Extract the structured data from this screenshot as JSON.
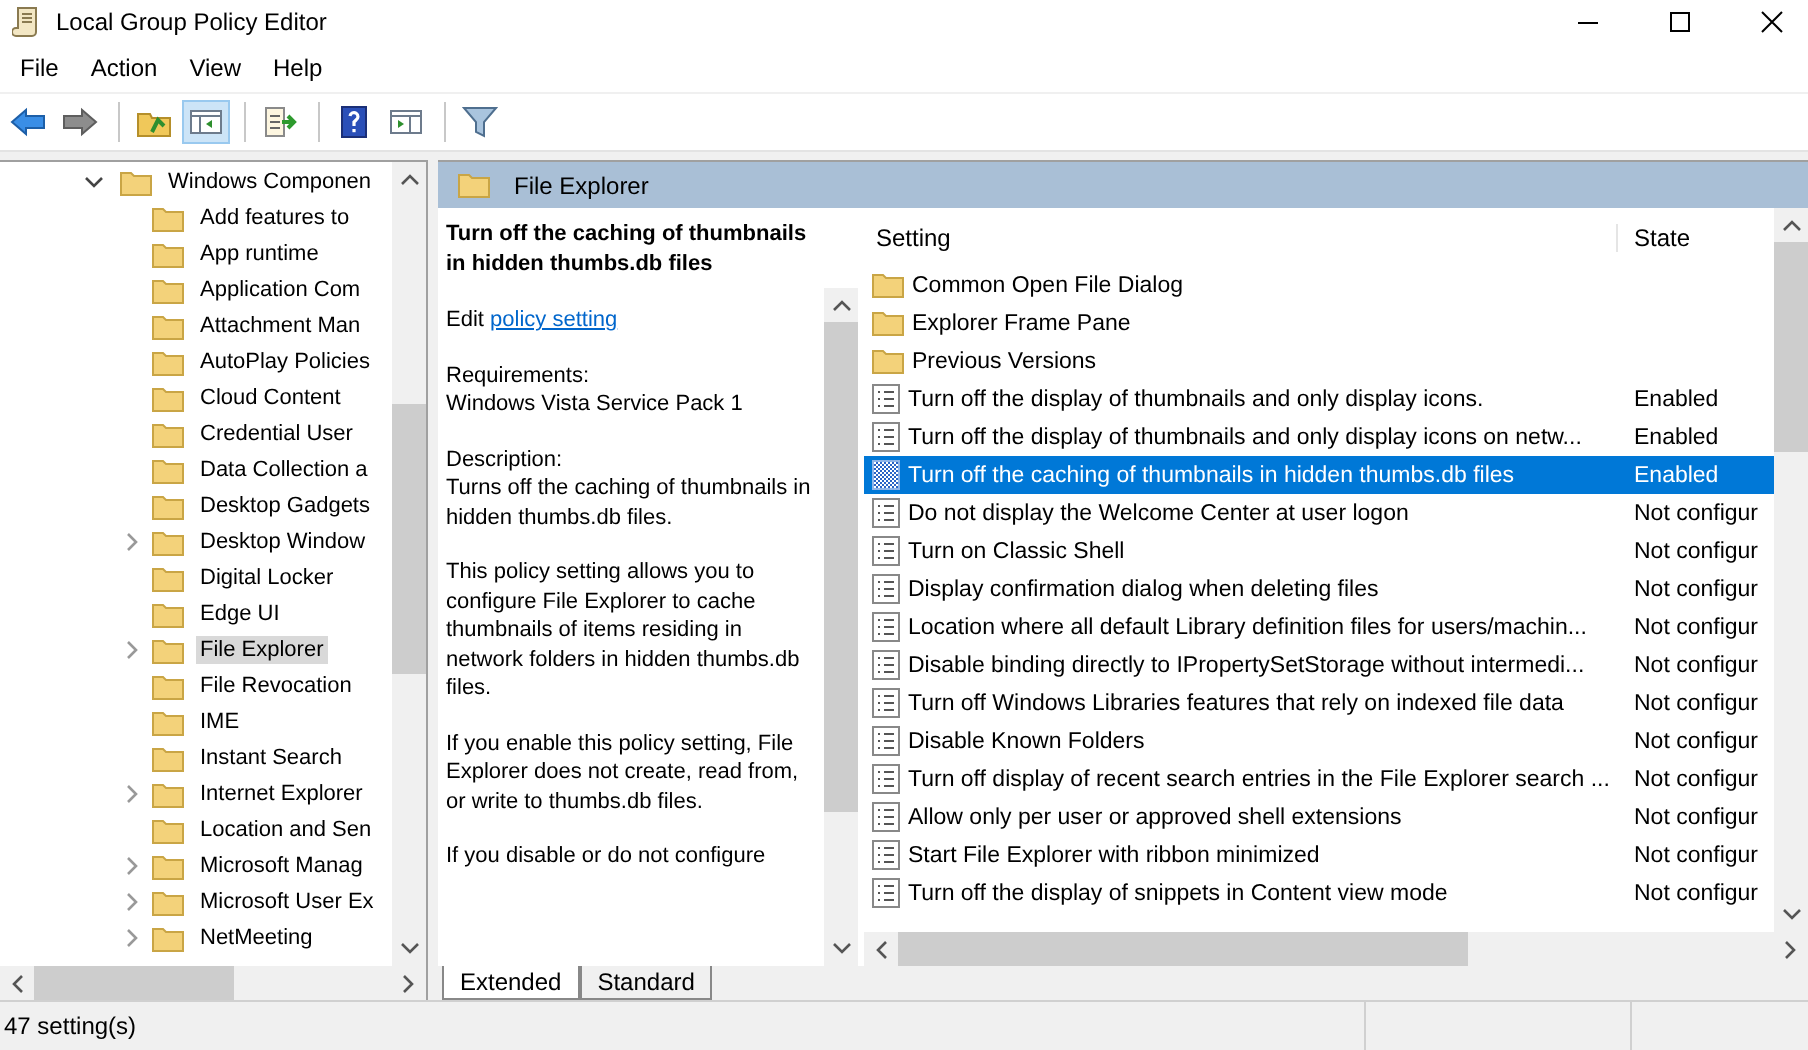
{
  "window": {
    "title": "Local Group Policy Editor"
  },
  "menu": [
    "File",
    "Action",
    "View",
    "Help"
  ],
  "toolbar": [
    {
      "kind": "back",
      "pressed": false
    },
    {
      "kind": "forward",
      "pressed": false
    },
    {
      "kind": "separator"
    },
    {
      "kind": "up",
      "pressed": false
    },
    {
      "kind": "tree-toggle",
      "pressed": true
    },
    {
      "kind": "separator"
    },
    {
      "kind": "export",
      "pressed": false
    },
    {
      "kind": "separator"
    },
    {
      "kind": "help",
      "pressed": false
    },
    {
      "kind": "pane-toggle",
      "pressed": false
    },
    {
      "kind": "separator"
    },
    {
      "kind": "filter",
      "pressed": false
    }
  ],
  "tree": {
    "label": "Windows Componen",
    "expanded": true,
    "children": [
      {
        "label": "Add features to",
        "expandable": false,
        "selected": false
      },
      {
        "label": "App runtime",
        "expandable": false,
        "selected": false
      },
      {
        "label": "Application Com",
        "expandable": false,
        "selected": false
      },
      {
        "label": "Attachment Man",
        "expandable": false,
        "selected": false
      },
      {
        "label": "AutoPlay Policies",
        "expandable": false,
        "selected": false
      },
      {
        "label": "Cloud Content",
        "expandable": false,
        "selected": false
      },
      {
        "label": "Credential User",
        "expandable": false,
        "selected": false
      },
      {
        "label": "Data Collection a",
        "expandable": false,
        "selected": false
      },
      {
        "label": "Desktop Gadgets",
        "expandable": false,
        "selected": false
      },
      {
        "label": "Desktop Window",
        "expandable": true,
        "selected": false
      },
      {
        "label": "Digital Locker",
        "expandable": false,
        "selected": false
      },
      {
        "label": "Edge UI",
        "expandable": false,
        "selected": false
      },
      {
        "label": "File Explorer",
        "expandable": true,
        "selected": true
      },
      {
        "label": "File Revocation",
        "expandable": false,
        "selected": false
      },
      {
        "label": "IME",
        "expandable": false,
        "selected": false
      },
      {
        "label": "Instant Search",
        "expandable": false,
        "selected": false
      },
      {
        "label": "Internet Explorer",
        "expandable": true,
        "selected": false
      },
      {
        "label": "Location and Sen",
        "expandable": false,
        "selected": false
      },
      {
        "label": "Microsoft Manag",
        "expandable": true,
        "selected": false
      },
      {
        "label": "Microsoft User Ex",
        "expandable": true,
        "selected": false
      },
      {
        "label": "NetMeeting",
        "expandable": true,
        "selected": false
      }
    ]
  },
  "detail": {
    "header": "File Explorer",
    "title": "Turn off the caching of thumbnails in hidden thumbs.db files",
    "edit_prefix": "Edit",
    "edit_link": "policy setting",
    "sections": [
      {
        "heading": "Requirements:",
        "text": "Windows Vista Service Pack 1"
      },
      {
        "heading": "Description:",
        "text": "Turns off the caching of thumbnails in hidden thumbs.db files."
      },
      {
        "text": "This policy setting allows you to configure File Explorer to cache thumbnails of items residing in network folders in hidden thumbs.db files."
      },
      {
        "text": "If you enable this policy setting, File Explorer does not create, read from, or write to thumbs.db files."
      },
      {
        "text": "If you disable or do not configure"
      }
    ]
  },
  "list": {
    "columns": [
      "Setting",
      "State"
    ],
    "rows": [
      {
        "kind": "folder",
        "setting": "Common Open File Dialog",
        "selected": false
      },
      {
        "kind": "folder",
        "setting": "Explorer Frame Pane",
        "selected": false
      },
      {
        "kind": "folder",
        "setting": "Previous Versions",
        "selected": false
      },
      {
        "kind": "policy",
        "setting": "Turn off the display of thumbnails and only display icons.",
        "state": "Enabled",
        "selected": false
      },
      {
        "kind": "policy",
        "setting": "Turn off the display of thumbnails and only display icons on netw...",
        "state": "Enabled",
        "selected": false
      },
      {
        "kind": "policy",
        "setting": "Turn off the caching of thumbnails in hidden thumbs.db files",
        "state": "Enabled",
        "selected": true
      },
      {
        "kind": "policy",
        "setting": "Do not display the Welcome Center at user logon",
        "state": "Not configur",
        "selected": false
      },
      {
        "kind": "policy",
        "setting": "Turn on Classic Shell",
        "state": "Not configur",
        "selected": false
      },
      {
        "kind": "policy",
        "setting": "Display confirmation dialog when deleting files",
        "state": "Not configur",
        "selected": false
      },
      {
        "kind": "policy",
        "setting": "Location where all default Library definition files for users/machin...",
        "state": "Not configur",
        "selected": false
      },
      {
        "kind": "policy",
        "setting": "Disable binding directly to IPropertySetStorage without intermedi...",
        "state": "Not configur",
        "selected": false
      },
      {
        "kind": "policy",
        "setting": "Turn off Windows Libraries features that rely on indexed file data",
        "state": "Not configur",
        "selected": false
      },
      {
        "kind": "policy",
        "setting": "Disable Known Folders",
        "state": "Not configur",
        "selected": false
      },
      {
        "kind": "policy",
        "setting": "Turn off display of recent search entries in the File Explorer search ...",
        "state": "Not configur",
        "selected": false
      },
      {
        "kind": "policy",
        "setting": "Allow only per user or approved shell extensions",
        "state": "Not configur",
        "selected": false
      },
      {
        "kind": "policy",
        "setting": "Start File Explorer with ribbon minimized",
        "state": "Not configur",
        "selected": false
      },
      {
        "kind": "policy",
        "setting": "Turn off the display of snippets in Content view mode",
        "state": "Not configur",
        "selected": false
      }
    ]
  },
  "tabs": [
    {
      "label": "Extended",
      "selected": true
    },
    {
      "label": "Standard",
      "selected": false
    }
  ],
  "status_bar": {
    "text": "47 setting(s)"
  }
}
